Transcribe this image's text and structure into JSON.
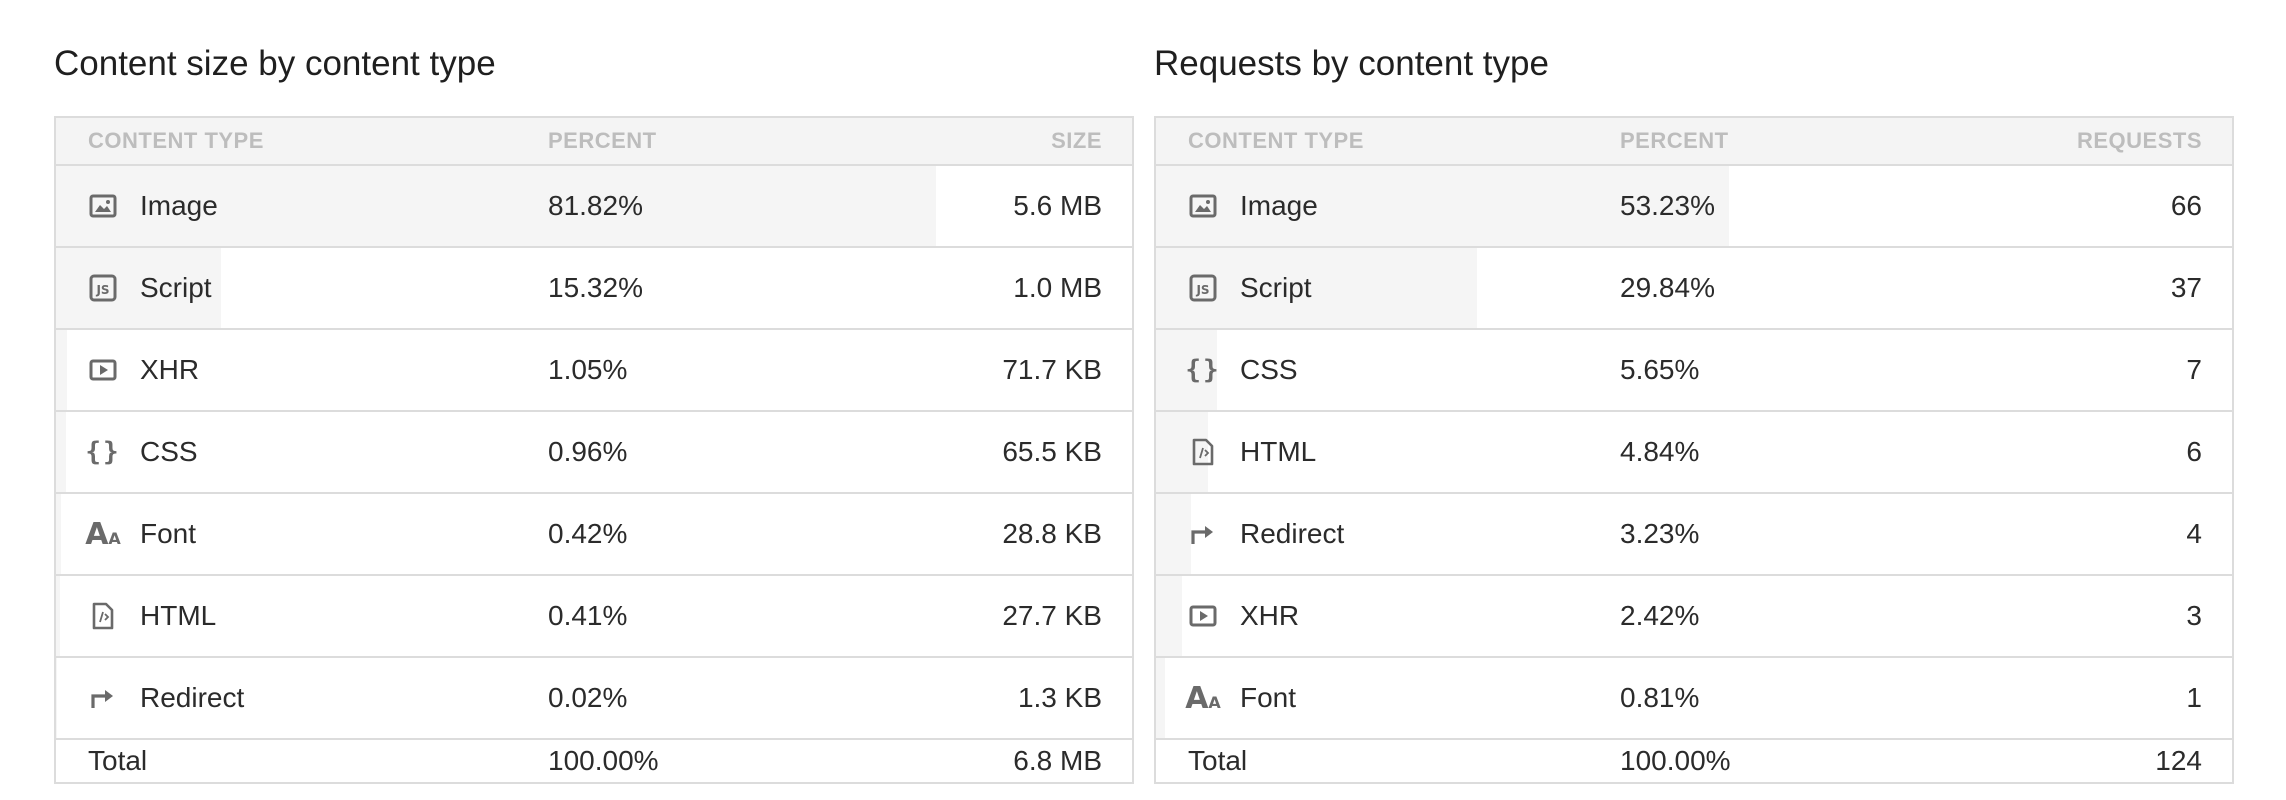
{
  "left_panel": {
    "title": "Content size by content type",
    "headers": {
      "type": "CONTENT TYPE",
      "percent": "PERCENT",
      "value": "SIZE"
    },
    "rows": [
      {
        "type": "Image",
        "icon": "image-icon",
        "percent": "81.82%",
        "value": "5.6 MB",
        "share": 0.8182
      },
      {
        "type": "Script",
        "icon": "script-icon",
        "percent": "15.32%",
        "value": "1.0 MB",
        "share": 0.1532
      },
      {
        "type": "XHR",
        "icon": "xhr-icon",
        "percent": "1.05%",
        "value": "71.7 KB",
        "share": 0.0105
      },
      {
        "type": "CSS",
        "icon": "css-icon",
        "percent": "0.96%",
        "value": "65.5 KB",
        "share": 0.0096
      },
      {
        "type": "Font",
        "icon": "font-icon",
        "percent": "0.42%",
        "value": "28.8 KB",
        "share": 0.0042
      },
      {
        "type": "HTML",
        "icon": "html-icon",
        "percent": "0.41%",
        "value": "27.7 KB",
        "share": 0.0041
      },
      {
        "type": "Redirect",
        "icon": "redirect-icon",
        "percent": "0.02%",
        "value": "1.3 KB",
        "share": 0.0002
      }
    ],
    "total": {
      "label": "Total",
      "percent": "100.00%",
      "value": "6.8 MB"
    }
  },
  "right_panel": {
    "title": "Requests by content type",
    "headers": {
      "type": "CONTENT TYPE",
      "percent": "PERCENT",
      "value": "REQUESTS"
    },
    "rows": [
      {
        "type": "Image",
        "icon": "image-icon",
        "percent": "53.23%",
        "value": "66",
        "share": 0.5323
      },
      {
        "type": "Script",
        "icon": "script-icon",
        "percent": "29.84%",
        "value": "37",
        "share": 0.2984
      },
      {
        "type": "CSS",
        "icon": "css-icon",
        "percent": "5.65%",
        "value": "7",
        "share": 0.0565
      },
      {
        "type": "HTML",
        "icon": "html-icon",
        "percent": "4.84%",
        "value": "6",
        "share": 0.0484
      },
      {
        "type": "Redirect",
        "icon": "redirect-icon",
        "percent": "3.23%",
        "value": "4",
        "share": 0.0323
      },
      {
        "type": "XHR",
        "icon": "xhr-icon",
        "percent": "2.42%",
        "value": "3",
        "share": 0.0242
      },
      {
        "type": "Font",
        "icon": "font-icon",
        "percent": "0.81%",
        "value": "1",
        "share": 0.0081
      }
    ],
    "total": {
      "label": "Total",
      "percent": "100.00%",
      "value": "124"
    }
  },
  "colors": {
    "bar_fill": "#f5f5f5",
    "header_bg": "#f4f4f4",
    "border": "#dcdcdc",
    "header_text": "#bdbdbd",
    "icon": "#6a6a6a"
  }
}
